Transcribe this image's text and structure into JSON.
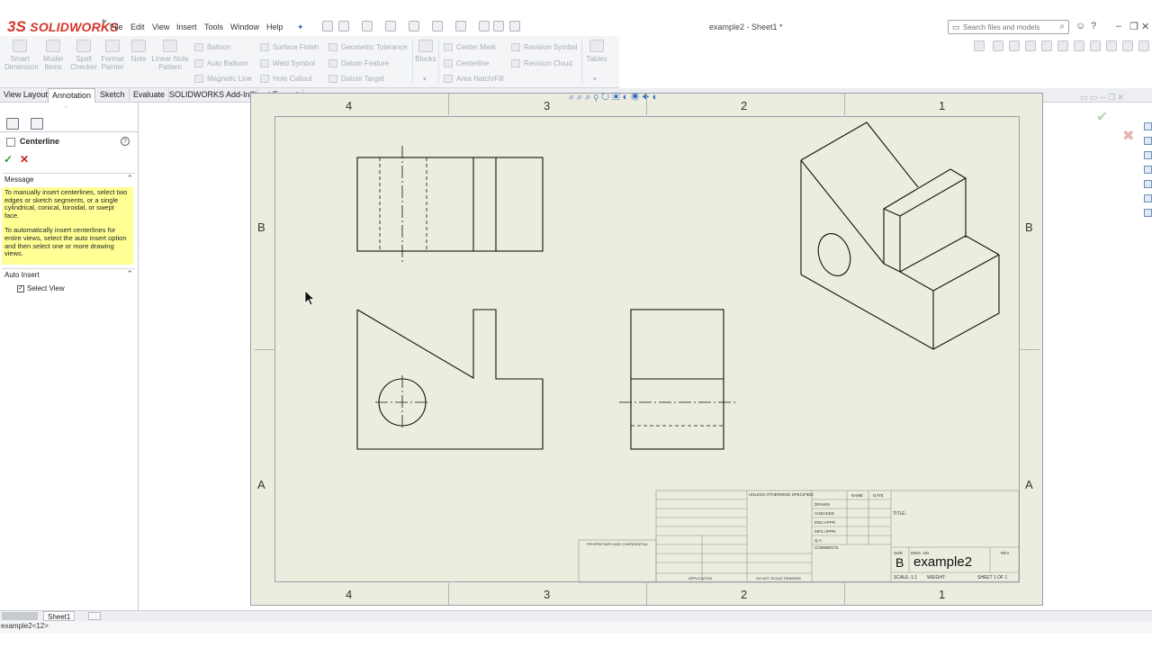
{
  "app": {
    "logo_prefix": "3S",
    "logo_name": "SOLIDWORKS",
    "doc_title": "example2 - Sheet1 *"
  },
  "menu": [
    "File",
    "Edit",
    "View",
    "Insert",
    "Tools",
    "Window",
    "Help"
  ],
  "search": {
    "placeholder": "Search files and models"
  },
  "ribbon": {
    "big": [
      {
        "label": "Smart Dimension"
      },
      {
        "label": "Model Items"
      },
      {
        "label": "Spell Checker"
      },
      {
        "label": "Format Painter"
      },
      {
        "label": "Note"
      },
      {
        "label": "Linear Note Pattern"
      }
    ],
    "col1": [
      "Balloon",
      "Auto Balloon",
      "Magnetic Line"
    ],
    "col2": [
      "Surface Finish",
      "Weld Symbol",
      "Hole Callout"
    ],
    "col3": [
      "Geometric Tolerance",
      "Datum Feature",
      "Datum Target"
    ],
    "blocks": "Blocks",
    "col4": [
      "Center Mark",
      "Centerline",
      "Area Hatch/Fill"
    ],
    "col5": [
      "Revision Symbol",
      "Revision Cloud"
    ],
    "tables": "Tables"
  },
  "tabs": [
    "View Layout",
    "Annotation",
    "Sketch",
    "Evaluate",
    "SOLIDWORKS Add-Ins",
    "Sheet Format"
  ],
  "property_manager": {
    "title": "Centerline",
    "message_title": "Message",
    "message_p1": "To manually insert centerlines, select two edges or sketch segments, or a single cylindrical, conical, toroidal, or swept face.",
    "message_p2": "To automatically insert centerlines for entire views, select the auto insert option and then select one or more drawing views.",
    "auto_insert_title": "Auto Insert",
    "select_view_label": "Select View",
    "select_view_checked": true
  },
  "drawing": {
    "zones_top": [
      "4",
      "3",
      "2",
      "1"
    ],
    "zones_side": [
      "B",
      "A"
    ],
    "title_block": {
      "unless": "UNLESS OTHERWISE SPECIFIED:",
      "name": "NAME",
      "date": "DATE",
      "drawn": "DRAWN",
      "checked": "CHECKED",
      "eng_appr": "ENG APPR.",
      "mfg_appr": "MFG APPR.",
      "qa": "Q.A.",
      "comments": "COMMENTS:",
      "title": "TITLE:",
      "size_hdr": "SIZE",
      "dwg_no_hdr": "DWG. NO.",
      "rev_hdr": "REV",
      "size": "B",
      "dwg_no": "example2",
      "scale": "SCALE: 1:1",
      "weight": "WEIGHT:",
      "sheet": "SHEET 1 OF 1",
      "proprietary": "PROPRIETARY AND CONFIDENTIAL",
      "application": "APPLICATION",
      "do_not_scale": "DO NOT SCALE DRAWING"
    }
  },
  "bottom": {
    "sheet_tab": "Sheet1",
    "status": "example2<12>"
  }
}
